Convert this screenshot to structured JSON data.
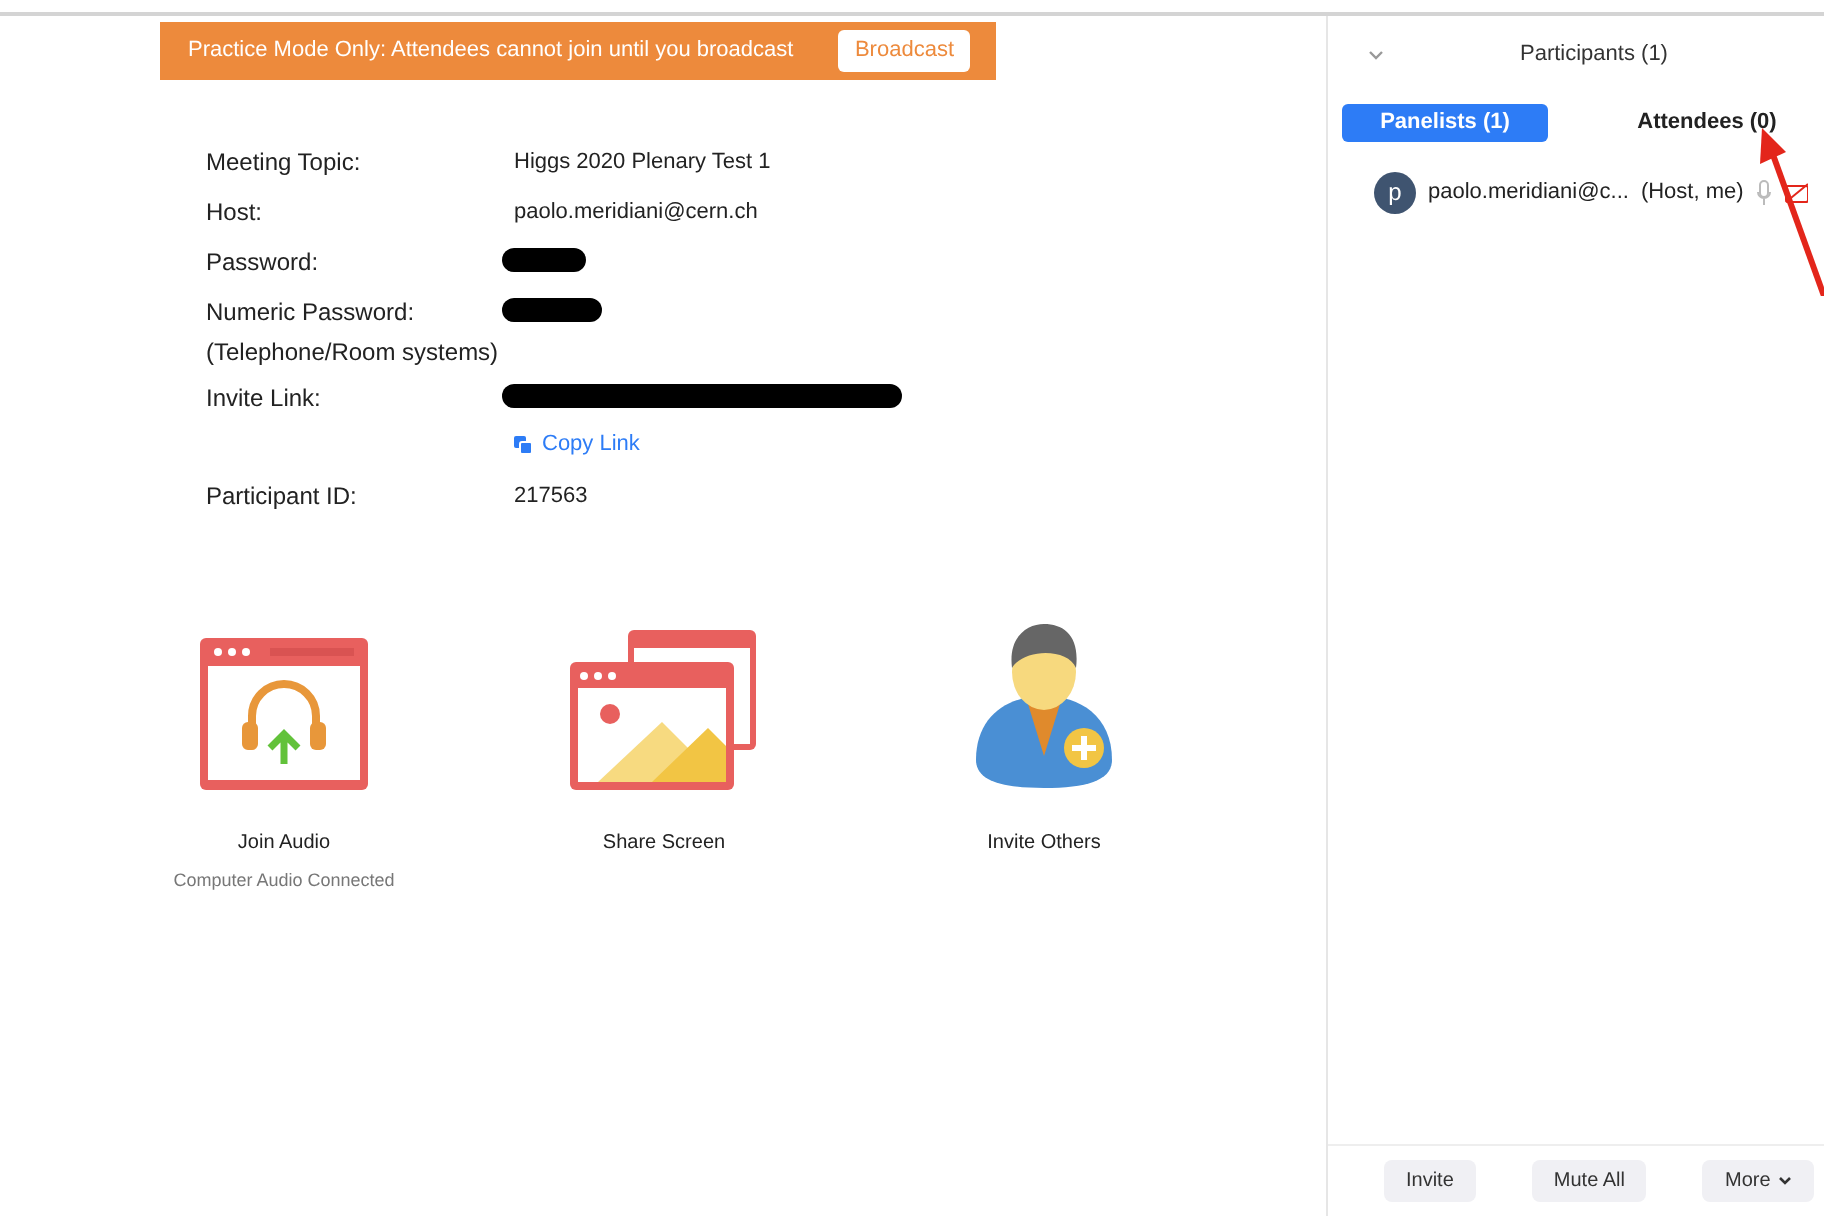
{
  "banner": {
    "message": "Practice Mode Only: Attendees cannot join until you broadcast",
    "button": "Broadcast"
  },
  "meeting_info": [
    {
      "label": "Meeting Topic:",
      "value": "Higgs 2020 Plenary Test 1"
    },
    {
      "label": "Host:",
      "value": "paolo.meridiani@cern.ch"
    },
    {
      "label": "Password:",
      "redacted": true
    },
    {
      "label": "Numeric Password:",
      "sublabel": "(Telephone/Room systems)",
      "redacted": true
    },
    {
      "label": "Invite Link:",
      "redacted": true,
      "link": "Copy Link"
    },
    {
      "label": "Participant ID:",
      "value": "217563"
    }
  ],
  "actions": [
    {
      "kind": "audio",
      "label": "Join Audio",
      "status": "Computer Audio Connected"
    },
    {
      "kind": "share",
      "label": "Share Screen"
    },
    {
      "kind": "invite",
      "label": "Invite Others"
    }
  ],
  "participants_panel": {
    "title": "Participants (1)",
    "tabs": [
      {
        "label": "Panelists (1)",
        "selected": true
      },
      {
        "label": "Attendees (0)",
        "selected": false
      }
    ],
    "participants": [
      {
        "initial": "p",
        "name": "paolo.meridiani@c...",
        "role": "(Host, me)",
        "muted": true,
        "video_off": true
      }
    ],
    "buttons": [
      {
        "label": "Invite",
        "dropdown": false
      },
      {
        "label": "Mute All",
        "dropdown": false
      },
      {
        "label": "More",
        "dropdown": true
      }
    ]
  }
}
